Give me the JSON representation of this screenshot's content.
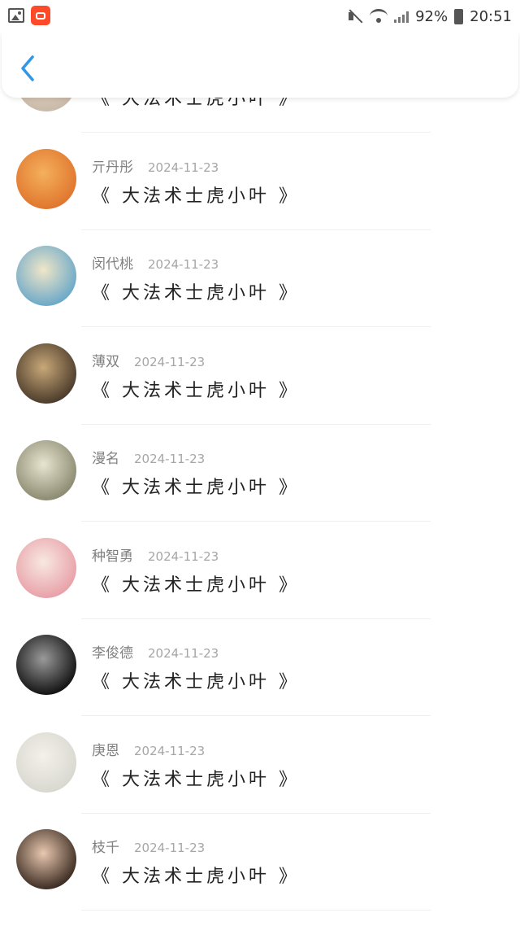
{
  "status_bar": {
    "battery": "92%",
    "time": "20:51"
  },
  "header": {
    "back_icon": "chevron-left-icon",
    "accent_color": "#2f97e8"
  },
  "comments": [
    {
      "username": "",
      "date": "",
      "text": "《 大法术士虎小叶 》",
      "avatar_colors": [
        "#c9b9a8",
        "#e8d8c8"
      ]
    },
    {
      "username": "亓丹彤",
      "date": "2024-11-23",
      "text": "《 大法术士虎小叶 》",
      "avatar_colors": [
        "#e0752e",
        "#f4b05c"
      ]
    },
    {
      "username": "闵代桃",
      "date": "2024-11-23",
      "text": "《 大法术士虎小叶 》",
      "avatar_colors": [
        "#6aa8c8",
        "#f0e6c8"
      ]
    },
    {
      "username": "薄双",
      "date": "2024-11-23",
      "text": "《 大法术士虎小叶 》",
      "avatar_colors": [
        "#4a3a2a",
        "#c8a878"
      ]
    },
    {
      "username": "漫名",
      "date": "2024-11-23",
      "text": "《 大法术士虎小叶 》",
      "avatar_colors": [
        "#8a8a70",
        "#e8e4d0"
      ]
    },
    {
      "username": "种智勇",
      "date": "2024-11-23",
      "text": "《 大法术士虎小叶 》",
      "avatar_colors": [
        "#e8a0a8",
        "#f8e8e0"
      ]
    },
    {
      "username": "李俊德",
      "date": "2024-11-23",
      "text": "《 大法术士虎小叶 》",
      "avatar_colors": [
        "#111111",
        "#9a9a9a"
      ]
    },
    {
      "username": "庚恩",
      "date": "2024-11-23",
      "text": "《 大法术士虎小叶 》",
      "avatar_colors": [
        "#d8d8d0",
        "#f4f0ea"
      ]
    },
    {
      "username": "枝千",
      "date": "2024-11-23",
      "text": "《 大法术士虎小叶 》",
      "avatar_colors": [
        "#3a2a20",
        "#e8c8b0"
      ]
    }
  ]
}
